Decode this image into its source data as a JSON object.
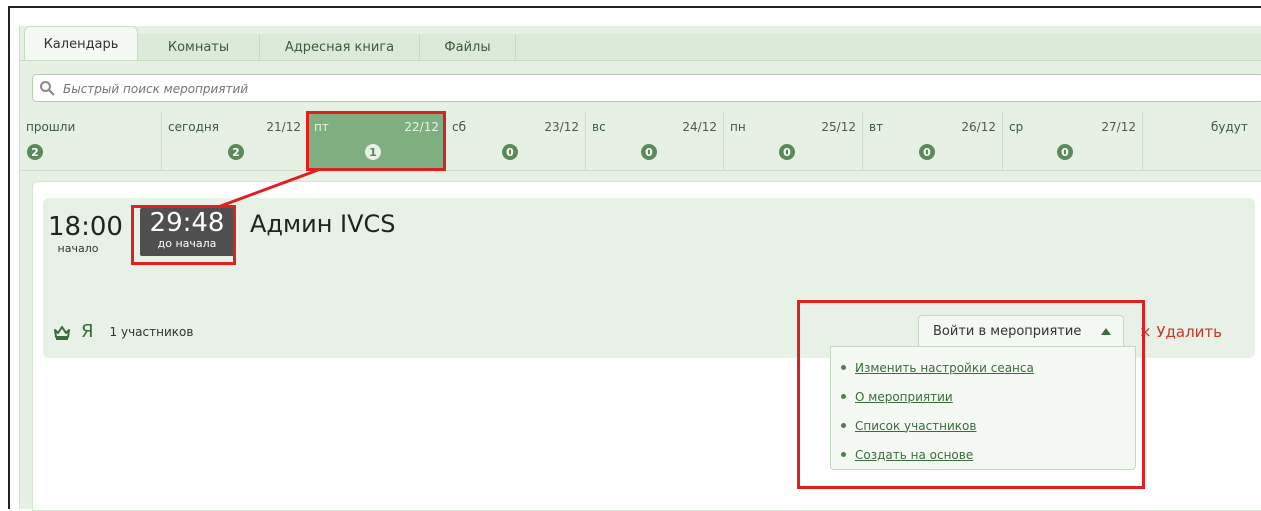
{
  "tabs": [
    {
      "label": "Календарь",
      "active": true
    },
    {
      "label": "Комнаты"
    },
    {
      "label": "Адресная книга"
    },
    {
      "label": "Файлы"
    }
  ],
  "search": {
    "placeholder": "Быстрый поиск мероприятий",
    "icon": "search-icon"
  },
  "days": [
    {
      "name": "прошли",
      "date": "",
      "count": "2"
    },
    {
      "name": "сегодня",
      "date": "21/12",
      "count": "2"
    },
    {
      "name": "пт",
      "date": "22/12",
      "count": "1",
      "selected": true
    },
    {
      "name": "сб",
      "date": "23/12",
      "count": "0"
    },
    {
      "name": "вс",
      "date": "24/12",
      "count": "0"
    },
    {
      "name": "пн",
      "date": "25/12",
      "count": "0"
    },
    {
      "name": "вт",
      "date": "26/12",
      "count": "0"
    },
    {
      "name": "ср",
      "date": "27/12",
      "count": "0"
    },
    {
      "name": "будут",
      "date": "",
      "count": ""
    }
  ],
  "event": {
    "start_time": "18:00",
    "start_label": "начало",
    "countdown": "29:48",
    "countdown_label": "до начала",
    "title": "Админ IVCS",
    "owner": "Я",
    "participants": "1 участников",
    "enter_label": "Войти в мероприятие",
    "delete_label": "Удалить",
    "delete_icon": "×",
    "menu": [
      "Изменить настройки сеанса",
      "О мероприятии",
      "Список участников",
      "Создать на основе"
    ]
  },
  "colors": {
    "accent": "#7fae80",
    "highlight": "#e02020",
    "badge": "#5a8a5a",
    "delete": "#c0392b"
  }
}
